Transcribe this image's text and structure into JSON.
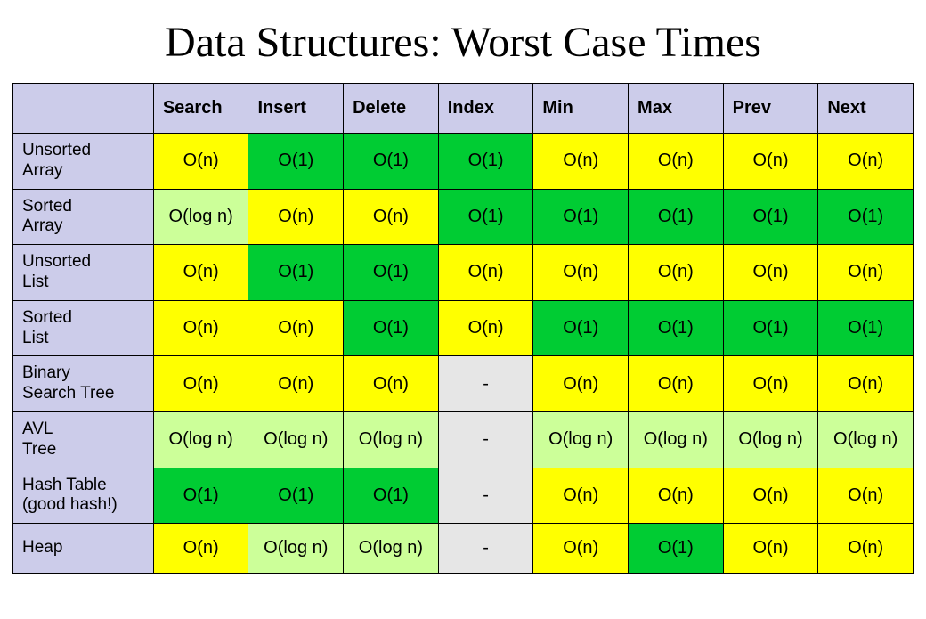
{
  "title": "Data Structures: Worst Case Times",
  "operations": [
    "Search",
    "Insert",
    "Delete",
    "Index",
    "Min",
    "Max",
    "Prev",
    "Next"
  ],
  "color_map": {
    "O(1)": "c-green",
    "O(log n)": "c-lgreen",
    "O(n)": "c-yellow",
    "-": "c-gray"
  },
  "rows": [
    {
      "name": "Unsorted\nArray",
      "values": [
        "O(n)",
        "O(1)",
        "O(1)",
        "O(1)",
        "O(n)",
        "O(n)",
        "O(n)",
        "O(n)"
      ]
    },
    {
      "name": "Sorted\nArray",
      "values": [
        "O(log n)",
        "O(n)",
        "O(n)",
        "O(1)",
        "O(1)",
        "O(1)",
        "O(1)",
        "O(1)"
      ]
    },
    {
      "name": "Unsorted\nList",
      "values": [
        "O(n)",
        "O(1)",
        "O(1)",
        "O(n)",
        "O(n)",
        "O(n)",
        "O(n)",
        "O(n)"
      ]
    },
    {
      "name": "Sorted\nList",
      "values": [
        "O(n)",
        "O(n)",
        "O(1)",
        "O(n)",
        "O(1)",
        "O(1)",
        "O(1)",
        "O(1)"
      ]
    },
    {
      "name": "Binary\nSearch Tree",
      "values": [
        "O(n)",
        "O(n)",
        "O(n)",
        "-",
        "O(n)",
        "O(n)",
        "O(n)",
        "O(n)"
      ]
    },
    {
      "name": "AVL\nTree",
      "values": [
        "O(log n)",
        "O(log n)",
        "O(log n)",
        "-",
        "O(log n)",
        "O(log n)",
        "O(log n)",
        "O(log n)"
      ]
    },
    {
      "name": "Hash Table\n(good hash!)",
      "values": [
        "O(1)",
        "O(1)",
        "O(1)",
        "-",
        "O(n)",
        "O(n)",
        "O(n)",
        "O(n)"
      ]
    },
    {
      "name": "Heap",
      "values": [
        "O(n)",
        "O(log n)",
        "O(log n)",
        "-",
        "O(n)",
        "O(1)",
        "O(n)",
        "O(n)"
      ]
    }
  ]
}
